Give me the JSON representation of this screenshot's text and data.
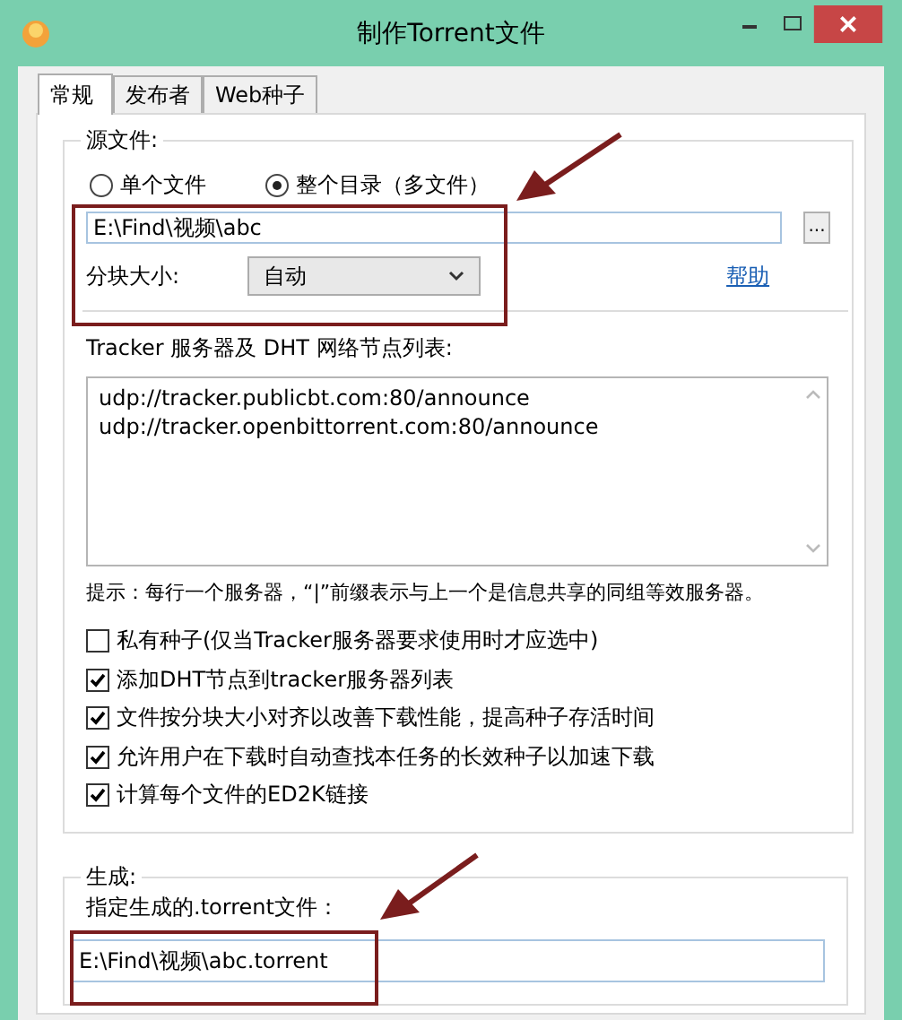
{
  "window": {
    "title": "制作Torrent文件"
  },
  "tabs": [
    {
      "label": "常规",
      "selected": true
    },
    {
      "label": "发布者",
      "selected": false
    },
    {
      "label": "Web种子",
      "selected": false
    }
  ],
  "source": {
    "title": "源文件:",
    "modes": [
      {
        "label": "单个文件",
        "selected": false
      },
      {
        "label": "整个目录（多文件）",
        "selected": true
      }
    ],
    "path": {
      "value": "E:\\Find\\视频\\abc"
    },
    "browse_button": "...",
    "piece_size": {
      "label": "分块大小:",
      "value": "自动"
    },
    "help_link": "帮助"
  },
  "trackers": {
    "label": "Tracker 服务器及 DHT 网络节点列表:",
    "lines": [
      "udp://tracker.publicbt.com:80/announce",
      "udp://tracker.openbittorrent.com:80/announce"
    ],
    "hint": "提示：每行一个服务器，“|”前缀表示与上一个是信息共享的同组等效服务器。"
  },
  "options": [
    {
      "label": "私有种子(仅当Tracker服务器要求使用时才应选中)",
      "checked": false
    },
    {
      "label": "添加DHT节点到tracker服务器列表",
      "checked": true
    },
    {
      "label": "文件按分块大小对齐以改善下载性能，提高种子存活时间",
      "checked": true
    },
    {
      "label": "允许用户在下载时自动查找本任务的长效种子以加速下载",
      "checked": true
    },
    {
      "label": "计算每个文件的ED2K链接",
      "checked": true
    }
  ],
  "output": {
    "title": "生成:",
    "label": "指定生成的.torrent文件：",
    "value": "E:\\Find\\视频\\abc.torrent"
  }
}
